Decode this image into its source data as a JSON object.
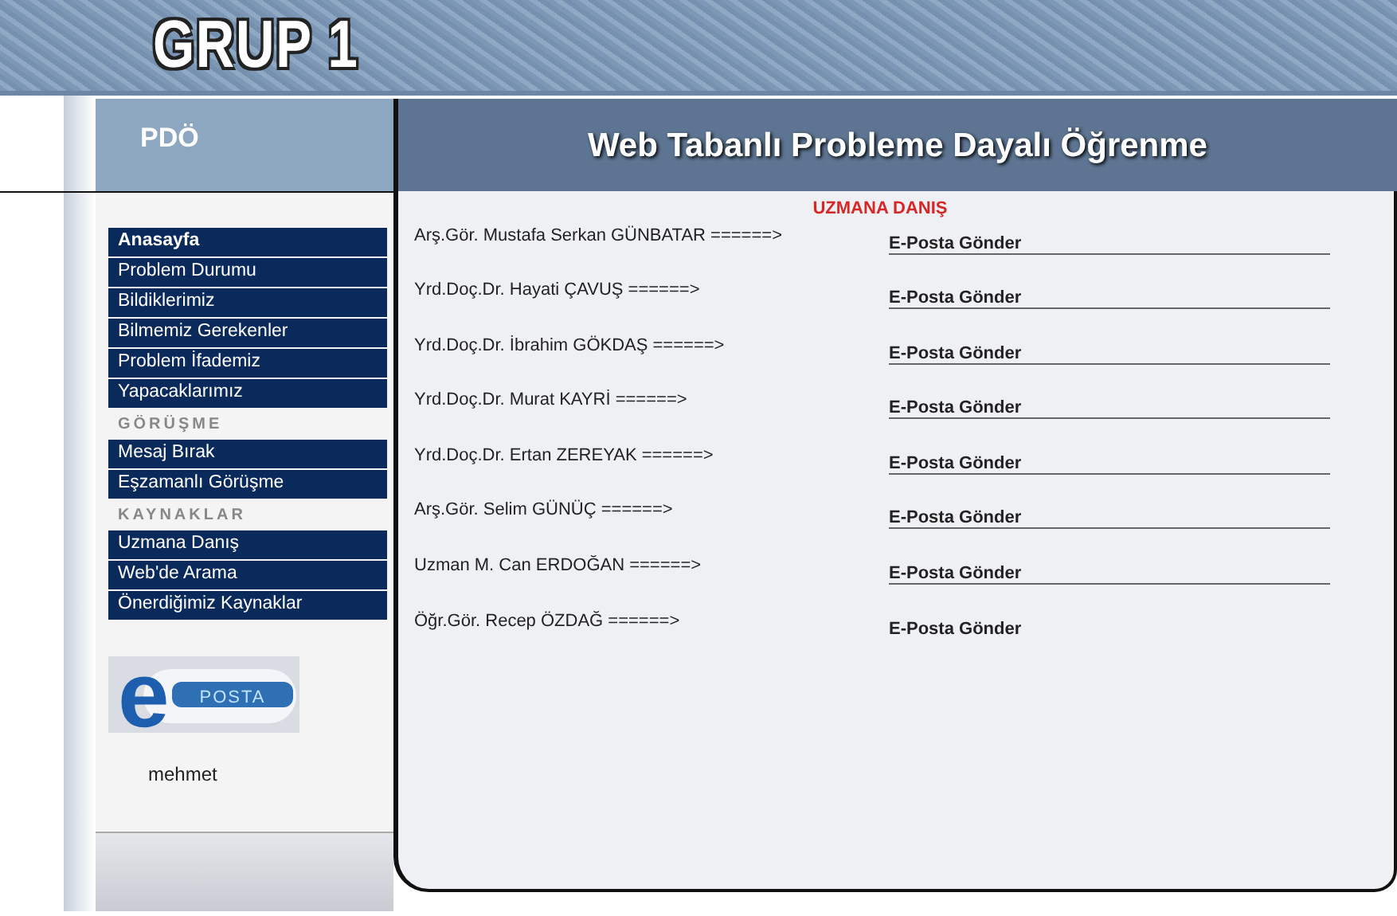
{
  "banner": {
    "title": "GRUP 1"
  },
  "header": {
    "short_title": "PDÖ",
    "title": "Web Tabanlı Probleme Dayalı Öğrenme"
  },
  "sidebar": {
    "items": [
      {
        "kind": "link",
        "label": "Anasayfa",
        "emphasized": true
      },
      {
        "kind": "link",
        "label": "Problem Durumu",
        "emphasized": false
      },
      {
        "kind": "link",
        "label": "Bildiklerimiz",
        "emphasized": false
      },
      {
        "kind": "link",
        "label": "Bilmemiz Gerekenler",
        "emphasized": false
      },
      {
        "kind": "link",
        "label": "Problem İfademiz",
        "emphasized": false
      },
      {
        "kind": "link",
        "label": "Yapacaklarımız",
        "emphasized": false
      },
      {
        "kind": "heading",
        "label": "GÖRÜŞME"
      },
      {
        "kind": "link",
        "label": "Mesaj Bırak",
        "emphasized": false
      },
      {
        "kind": "link",
        "label": "Eşzamanlı Görüşme",
        "emphasized": false
      },
      {
        "kind": "heading",
        "label": "KAYNAKLAR"
      },
      {
        "kind": "link",
        "label": "Uzmana Danış",
        "emphasized": false
      },
      {
        "kind": "link",
        "label": "Web'de Arama",
        "emphasized": false
      },
      {
        "kind": "link",
        "label": "Önerdiğimiz Kaynaklar",
        "emphasized": false
      }
    ],
    "logo": {
      "letter": "e",
      "label": "POSTA"
    },
    "user": "mehmet"
  },
  "content": {
    "title": "UZMANA DANIŞ",
    "rows": [
      {
        "name": "Arş.Gör. Mustafa Serkan GÜNBATAR ======>",
        "link": "E-Posta Gönder"
      },
      {
        "name": "Yrd.Doç.Dr. Hayati ÇAVUŞ ======>",
        "link": "E-Posta Gönder"
      },
      {
        "name": "Yrd.Doç.Dr. İbrahim GÖKDAŞ ======>",
        "link": "E-Posta Gönder"
      },
      {
        "name": "Yrd.Doç.Dr. Murat KAYRİ ======>",
        "link": "E-Posta Gönder"
      },
      {
        "name": "Yrd.Doç.Dr. Ertan ZEREYAK ======>",
        "link": "E-Posta Gönder"
      },
      {
        "name": "Arş.Gör. Selim GÜNÜÇ ======>",
        "link": "E-Posta Gönder"
      },
      {
        "name": "Uzman M. Can ERDOĞAN ======>",
        "link": "E-Posta Gönder"
      },
      {
        "name": "Öğr.Gör. Recep ÖZDAĞ ======>",
        "link": "E-Posta Gönder"
      }
    ]
  }
}
